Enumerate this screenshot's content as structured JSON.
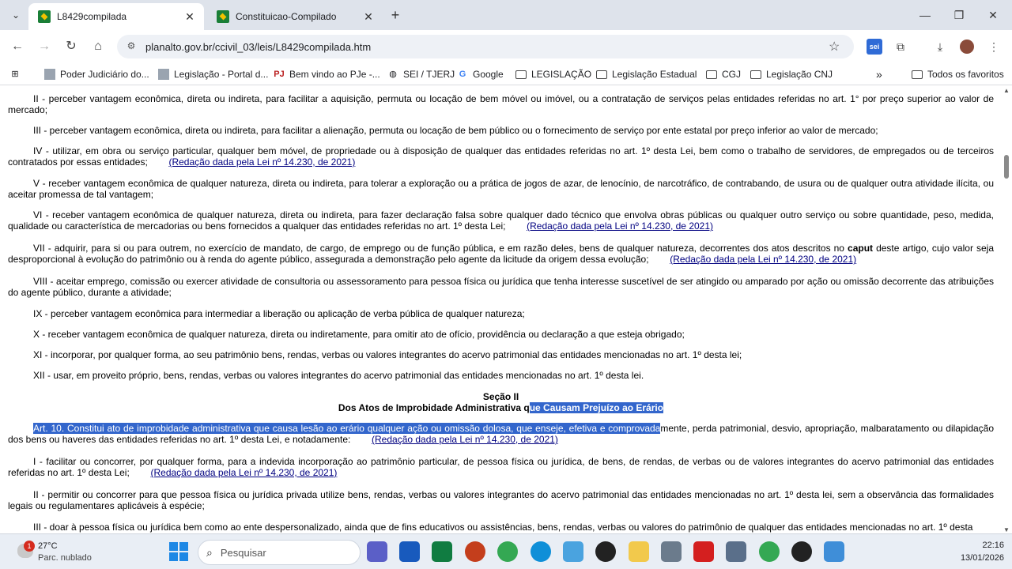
{
  "tabs": [
    {
      "title": "L8429compilada",
      "close": "✕"
    },
    {
      "title": "Constituicao-Compilado",
      "close": "✕"
    }
  ],
  "new_tab_symbol": "+",
  "window_controls": {
    "minimize": "—",
    "maximize": "❐",
    "close": "✕"
  },
  "address_bar": {
    "url": "planalto.gov.br/ccivil_03/leis/L8429compilada.htm"
  },
  "extension_label": "sei",
  "bookmarks": [
    {
      "label": "Poder Judiciário do..."
    },
    {
      "label": "Legislação - Portal d..."
    },
    {
      "label": "Bem vindo ao PJe -..."
    },
    {
      "label": "SEI / TJERJ"
    },
    {
      "label": "Google"
    },
    {
      "label": "LEGISLAÇÃO"
    },
    {
      "label": "Legislação Estadual"
    },
    {
      "label": "CGJ"
    },
    {
      "label": "Legislação CNJ"
    }
  ],
  "bookmarks_overflow": "»",
  "all_bookmarks": "Todos os favoritos",
  "document": {
    "p1": "II - perceber vantagem econômica, direta ou indireta, para facilitar a aquisição, permuta ou locação de bem móvel ou imóvel, ou a contratação de serviços pelas entidades referidas no art. 1° por preço superior ao valor de mercado;",
    "p2": "III - perceber vantagem econômica, direta ou indireta, para facilitar a alienação, permuta ou locação de bem público ou o fornecimento de serviço por ente estatal por preço inferior ao valor de mercado;",
    "p3": "IV - utilizar, em obra ou serviço particular, qualquer bem móvel, de propriedade ou à disposição de qualquer das entidades referidas no art. 1º desta Lei, bem como o trabalho de servidores, de empregados ou de terceiros contratados por essas entidades;",
    "p4": "V - receber vantagem econômica de qualquer natureza, direta ou indireta, para tolerar a exploração ou a prática de jogos de azar, de lenocínio, de narcotráfico, de contrabando, de usura ou de qualquer outra atividade ilícita, ou aceitar promessa de tal vantagem;",
    "p5": "VI - receber vantagem econômica de qualquer natureza, direta ou indireta, para fazer declaração falsa sobre qualquer dado técnico que envolva obras públicas ou qualquer outro serviço ou sobre quantidade, peso, medida, qualidade ou característica de mercadorias ou bens fornecidos a qualquer das entidades referidas no art. 1º desta Lei;",
    "p6a": "VII - adquirir, para si ou para outrem, no exercício de mandato, de cargo, de emprego ou de função pública, e em razão deles, bens de qualquer natureza, decorrentes dos atos descritos no ",
    "p6_caput": "caput",
    "p6b": " deste artigo, cujo valor seja desproporcional à evolução do patrimônio ou à renda do agente público, assegurada a demonstração pelo agente da licitude da origem dessa evolução;",
    "p7": "VIII - aceitar emprego, comissão ou exercer atividade de consultoria ou assessoramento para pessoa física ou jurídica que tenha interesse suscetível de ser atingido ou amparado por ação ou omissão decorrente das atribuições do agente público, durante a atividade;",
    "p8": "IX - perceber vantagem econômica para intermediar a liberação ou aplicação de verba pública de qualquer natureza;",
    "p9": "X - receber vantagem econômica de qualquer natureza, direta ou indiretamente, para omitir ato de ofício, providência ou declaração a que esteja obrigado;",
    "p10": "XI - incorporar, por qualquer forma, ao seu patrimônio bens, rendas, verbas ou valores integrantes do acervo patrimonial das entidades mencionadas no art. 1º desta lei;",
    "p11": "XII - usar, em proveito próprio, bens, rendas, verbas ou valores integrantes do acervo patrimonial das entidades mencionadas no art. 1º desta lei.",
    "section_title": "Seção II",
    "section_sub_a": "Dos Atos de Improbidade Administrativa q",
    "section_sub_b": "ue Causam Prejuízo ao Erário",
    "art10_hl": "Art. 10. Constitui ato de improbidade administrativa que causa lesão ao erário qualquer ação ou omissão dolosa, que enseje, efetiva e comprovada",
    "art10_rest": "mente, perda patrimonial, desvio, apropriação, malbaratamento ou dilapidação dos bens ou haveres das entidades referidas no art. 1º desta Lei, e notadamente:",
    "q1": "I - facilitar ou concorrer, por qualquer forma, para a indevida incorporação ao patrimônio particular, de pessoa física ou jurídica, de bens, de rendas, de verbas ou de valores integrantes do acervo patrimonial das entidades referidas no art. 1º desta Lei;",
    "q2": "II - permitir ou concorrer para que pessoa física ou jurídica privada utilize bens, rendas, verbas ou valores integrantes do acervo patrimonial das entidades mencionadas no art. 1º desta lei, sem a observância das formalidades legais ou regulamentares aplicáveis à espécie;",
    "q3": "III - doar à pessoa física ou jurídica bem como ao ente despersonalizado, ainda que de fins educativos ou assistências, bens, rendas, verbas ou valores do patrimônio de qualquer das entidades mencionadas no art. 1º desta",
    "redacao": "(Redação dada pela Lei nº 14.230, de 2021)"
  },
  "taskbar": {
    "weather_badge": "1",
    "temperature": "27°C",
    "condition": "Parc. nublado",
    "search_placeholder": "Pesquisar",
    "time": "22:16",
    "date": "13/01/2026"
  }
}
